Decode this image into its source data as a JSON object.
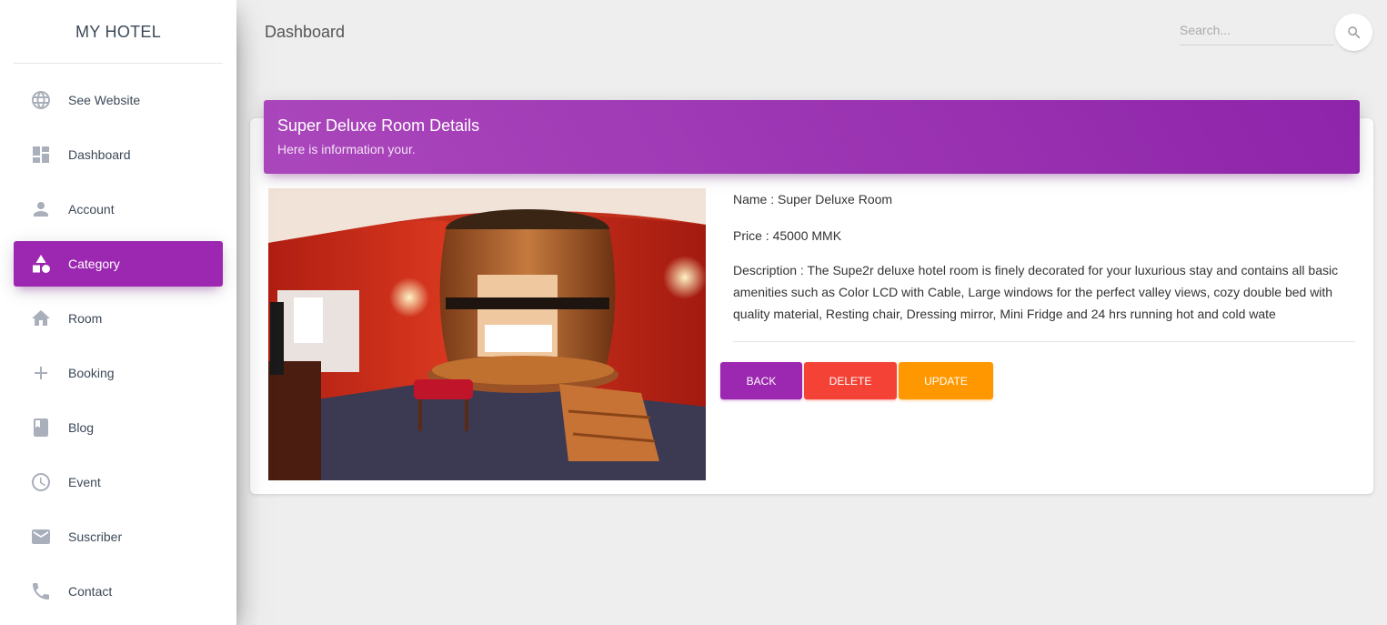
{
  "brand": {
    "name": "MY HOTEL"
  },
  "sidebar": {
    "items": [
      {
        "label": "See Website",
        "icon": "globe-icon",
        "active": false
      },
      {
        "label": "Dashboard",
        "icon": "dashboard-icon",
        "active": false
      },
      {
        "label": "Account",
        "icon": "person-icon",
        "active": false
      },
      {
        "label": "Category",
        "icon": "category-icon",
        "active": true
      },
      {
        "label": "Room",
        "icon": "home-icon",
        "active": false
      },
      {
        "label": "Booking",
        "icon": "plus-icon",
        "active": false
      },
      {
        "label": "Blog",
        "icon": "book-icon",
        "active": false
      },
      {
        "label": "Event",
        "icon": "clock-icon",
        "active": false
      },
      {
        "label": "Suscriber",
        "icon": "mail-icon",
        "active": false
      },
      {
        "label": "Contact",
        "icon": "phone-icon",
        "active": false
      }
    ]
  },
  "header": {
    "title": "Dashboard",
    "search_placeholder": "Search..."
  },
  "card": {
    "title": "Super Deluxe Room Details",
    "subtitle": "Here is information your.",
    "image_alt": "room-photo"
  },
  "details": {
    "name": "Name : Super Deluxe Room",
    "price": "Price : 45000 MMK",
    "description": "Description : The Supe2r deluxe hotel room is finely decorated for your luxurious stay and contains all basic amenities such as Color LCD with Cable, Large windows for the perfect valley views, cozy double bed with quality material, Resting chair, Dressing mirror, Mini Fridge and 24 hrs running hot and cold wate"
  },
  "actions": {
    "back": "BACK",
    "delete": "DELETE",
    "update": "UPDATE"
  },
  "colors": {
    "primary": "#9c27b0",
    "danger": "#f44336",
    "warning": "#ff9800",
    "background": "#eeeeee"
  }
}
